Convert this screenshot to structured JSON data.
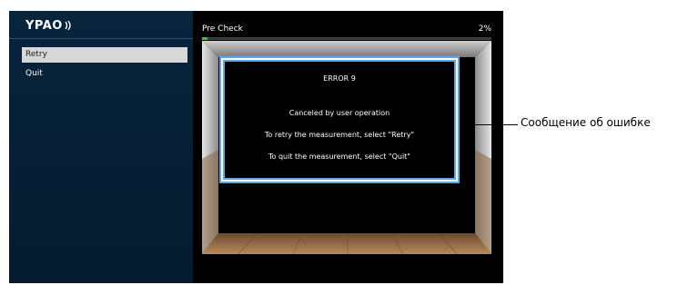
{
  "app": {
    "logo_text": "YPAO"
  },
  "menu": {
    "items": [
      {
        "label": "Retry",
        "selected": true
      },
      {
        "label": "Quit",
        "selected": false
      }
    ]
  },
  "measurement": {
    "stage_label": "Pre Check",
    "progress_text": "2%",
    "progress_value": 0.02
  },
  "error": {
    "title": "ERROR 9",
    "message": "Canceled by user operation",
    "retry_hint": "To retry the measurement, select \"Retry\"",
    "quit_hint": "To quit the measurement, select \"Quit\""
  },
  "callout": {
    "label": "Сообщение об ошибке"
  },
  "colors": {
    "menu_background": "#062036",
    "selected_item": "#d8d8d8",
    "progress_fill": "#3fbf3f",
    "dialog_border_accent": "#5aa8e8"
  }
}
